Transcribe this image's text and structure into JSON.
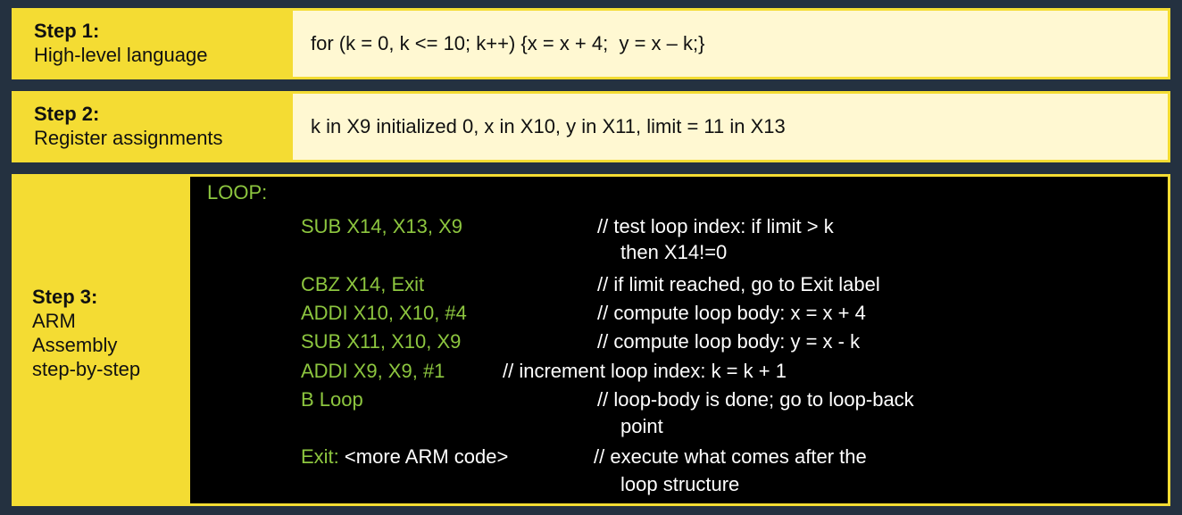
{
  "step1": {
    "title": "Step 1:",
    "subtitle": "High-level language",
    "content": "for (k = 0, k <= 10; k++) {x = x + 4;  y = x – k;}"
  },
  "step2": {
    "title": "Step 2:",
    "subtitle": "Register assignments",
    "content": "k in X9 initialized 0, x in X10, y in X11, limit = 11 in X13"
  },
  "step3": {
    "title": "Step 3:",
    "subtitle_lines": [
      "ARM",
      "Assembly",
      "step-by-step"
    ],
    "code": {
      "loop_label": "LOOP:",
      "lines": [
        {
          "instr": "SUB X14, X13, X9",
          "comment": "// test loop index: if limit > k"
        },
        {
          "comment_cont": "then X14!=0"
        },
        {
          "instr": "CBZ X14, Exit",
          "comment": "// if limit reached, go to Exit label"
        },
        {
          "instr": "ADDI X10, X10, #4",
          "comment": "// compute loop body: x = x + 4"
        },
        {
          "instr": "SUB X11, X10, X9",
          "comment": "// compute loop body: y = x - k"
        },
        {
          "instr": "ADDI X9, X9, #1",
          "comment": "// increment loop index: k = k + 1"
        },
        {
          "instr": "B Loop",
          "comment": "// loop-body is done; go to loop-back"
        },
        {
          "comment_cont": "point"
        },
        {
          "instr": "Exit:",
          "instr_extra": " <more ARM code>",
          "comment": "// execute what comes after the"
        },
        {
          "comment_cont": "loop structure"
        }
      ]
    }
  },
  "colors": {
    "background": "#243140",
    "label_yellow": "#f4dc33",
    "content_cream": "#fff8d2",
    "code_background": "#000000",
    "code_green": "#8dc63f",
    "code_white": "#ffffff"
  }
}
